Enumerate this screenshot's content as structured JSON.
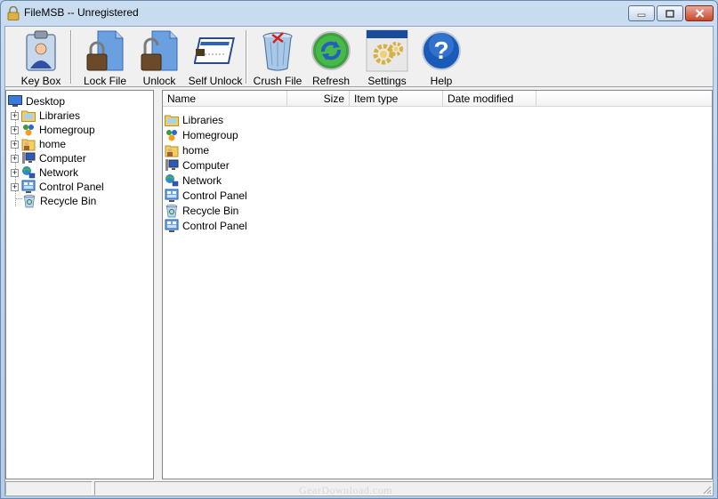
{
  "window": {
    "title": "FileMSB -- Unregistered"
  },
  "toolbar": {
    "items": [
      {
        "label": "Key Box",
        "icon": "key-box-icon"
      },
      {
        "label": "Lock File",
        "icon": "lock-file-icon"
      },
      {
        "label": "Unlock",
        "icon": "unlock-icon"
      },
      {
        "label": "Self Unlock",
        "icon": "self-unlock-icon"
      },
      {
        "label": "Crush File",
        "icon": "trash-icon"
      },
      {
        "label": "Refresh",
        "icon": "refresh-icon"
      },
      {
        "label": "Settings",
        "icon": "gear-icon"
      },
      {
        "label": "Help",
        "icon": "help-icon"
      }
    ]
  },
  "tree": {
    "root": "Desktop",
    "items": [
      {
        "label": "Libraries",
        "expandable": true,
        "icon": "libraries-icon"
      },
      {
        "label": "Homegroup",
        "expandable": true,
        "icon": "homegroup-icon"
      },
      {
        "label": "home",
        "expandable": true,
        "icon": "user-folder-icon"
      },
      {
        "label": "Computer",
        "expandable": true,
        "icon": "computer-icon"
      },
      {
        "label": "Network",
        "expandable": true,
        "icon": "network-icon"
      },
      {
        "label": "Control Panel",
        "expandable": true,
        "icon": "control-panel-icon"
      },
      {
        "label": "Recycle Bin",
        "expandable": false,
        "icon": "recycle-bin-icon"
      }
    ]
  },
  "list": {
    "columns": [
      "Name",
      "Size",
      "Item type",
      "Date modified"
    ],
    "rows": [
      {
        "name": "Libraries",
        "icon": "libraries-icon"
      },
      {
        "name": "Homegroup",
        "icon": "homegroup-icon"
      },
      {
        "name": "home",
        "icon": "user-folder-icon"
      },
      {
        "name": "Computer",
        "icon": "computer-icon"
      },
      {
        "name": "Network",
        "icon": "network-icon"
      },
      {
        "name": "Control Panel",
        "icon": "control-panel-icon"
      },
      {
        "name": "Recycle Bin",
        "icon": "recycle-bin-icon"
      },
      {
        "name": "Control Panel",
        "icon": "control-panel-icon"
      }
    ]
  },
  "watermark": "GearDownload.com"
}
